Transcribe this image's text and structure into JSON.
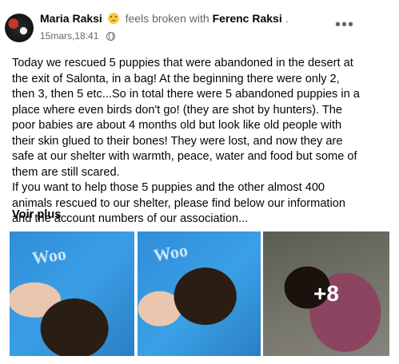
{
  "post": {
    "author": "Maria Raksi",
    "feeling": "feels broken with",
    "tagged": "Ferenc Raksi",
    "tagged_suffix": ".",
    "timestamp": "15mars,18:41",
    "more_icon": "more-horizontal-icon",
    "privacy_icon": "globe-icon",
    "text_lines": [
      "Today we rescued 5 puppies that were abandoned in the desert at the exit of Salonta, in a bag! At the beginning there were only 2, then 3, then 5 etc...So in total there were 5 abandoned puppies in a place where even birds don't go! (they are shot by hunters). The poor babies are about 4 months old but look like old people with their skin glued to their bones! They were lost, and now they are safe at our shelter with warmth, peace, water and food but some of them are still scared.",
      "If you want to help those 5 puppies and the other almost 400 animals rescued to our shelter, please find below our information and the account numbers of our association..."
    ],
    "see_more": "Voir plus",
    "photos": {
      "extra_count": "+8",
      "shirt_text": "Woo"
    }
  }
}
